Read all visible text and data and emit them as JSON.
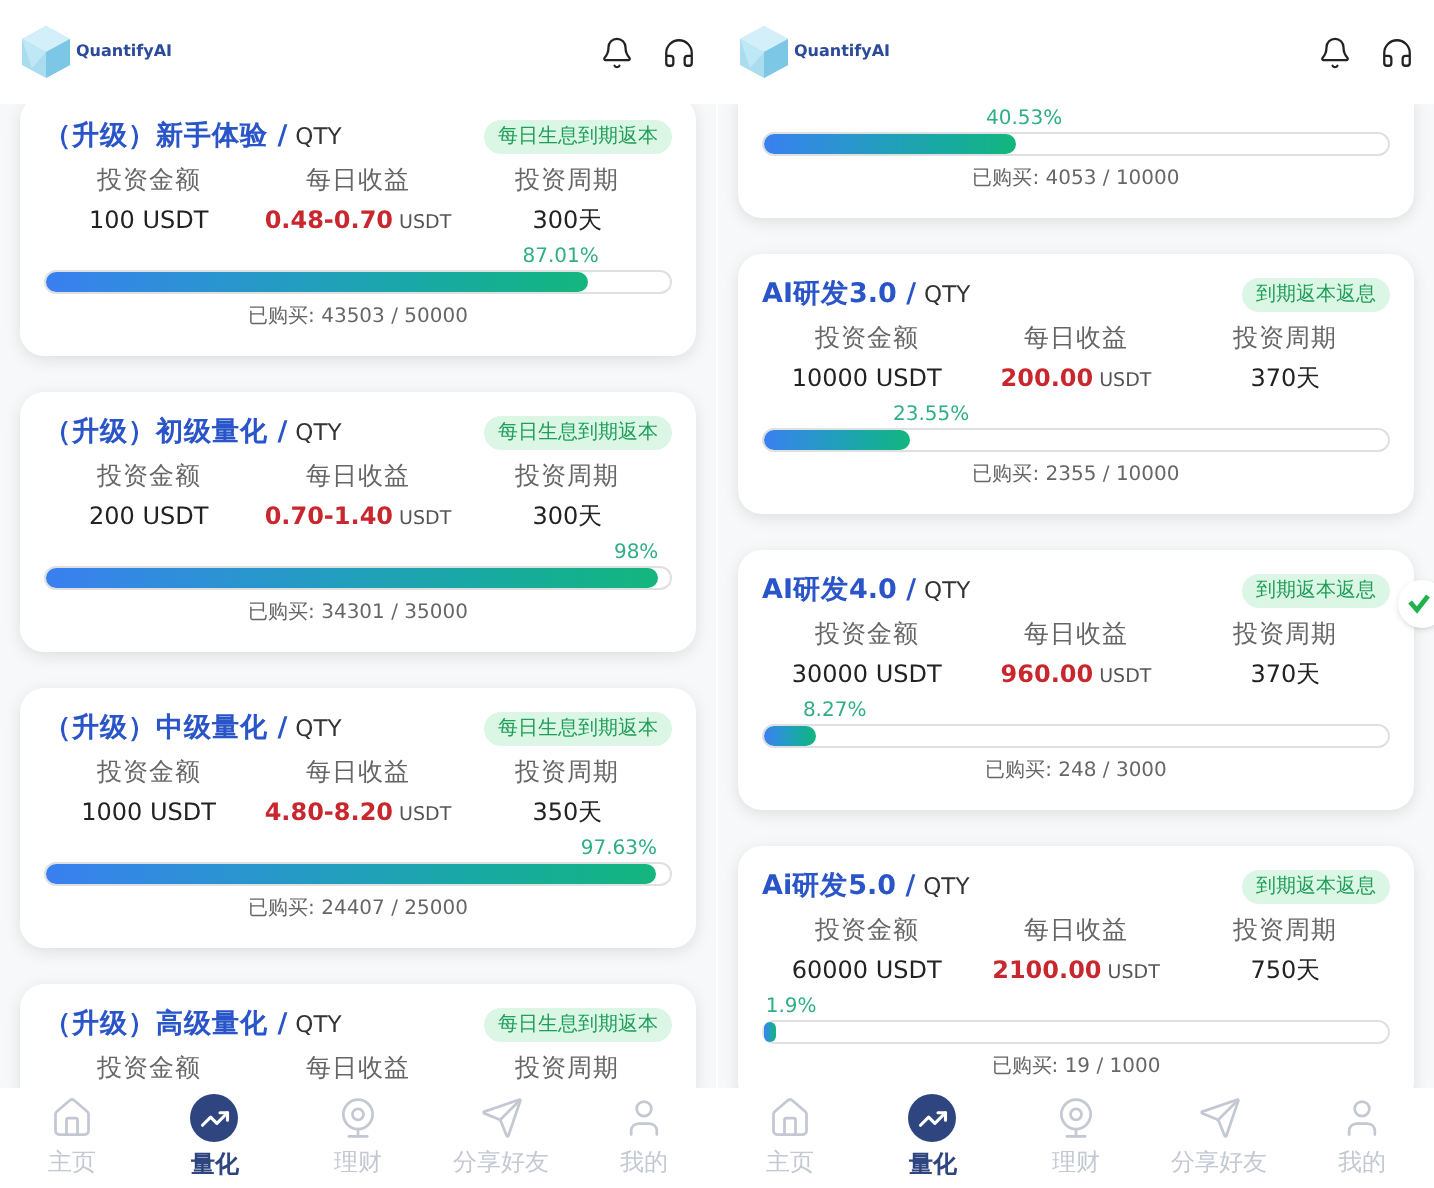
{
  "screens": [
    {
      "header": {
        "brand": "QuantifyAI"
      },
      "products": [
        {
          "title": "（升级）新手体验 /",
          "unit": "QTY",
          "badge": "每日生息到期返本",
          "stats": [
            {
              "label": "投资金额",
              "value": "100 USDT"
            },
            {
              "label": "每日收益",
              "value": "0.48-0.70",
              "suffix": "USDT"
            },
            {
              "label": "投资周期",
              "value": "300天"
            }
          ],
          "percent": "87.01%",
          "level": 0.8701,
          "purchased": "已购买: 43503 / 50000"
        },
        {
          "title": "（升级）初级量化 /",
          "unit": "QTY",
          "badge": "每日生息到期返本",
          "stats": [
            {
              "label": "投资金额",
              "value": "200 USDT"
            },
            {
              "label": "每日收益",
              "value": "0.70-1.40",
              "suffix": "USDT"
            },
            {
              "label": "投资周期",
              "value": "300天"
            }
          ],
          "percent": "98%",
          "level": 0.98,
          "purchased": "已购买: 34301 / 35000"
        },
        {
          "title": "（升级）中级量化 /",
          "unit": "QTY",
          "badge": "每日生息到期返本",
          "stats": [
            {
              "label": "投资金额",
              "value": "1000 USDT"
            },
            {
              "label": "每日收益",
              "value": "4.80-8.20",
              "suffix": "USDT"
            },
            {
              "label": "投资周期",
              "value": "350天"
            }
          ],
          "percent": "97.63%",
          "level": 0.9763,
          "purchased": "已购买: 24407 / 25000"
        },
        {
          "title": "（升级）高级量化 /",
          "unit": "QTY",
          "badge": "每日生息到期返本",
          "stats": [
            {
              "label": "投资金额"
            },
            {
              "label": "每日收益"
            },
            {
              "label": "投资周期"
            }
          ]
        }
      ],
      "nav": [
        {
          "label": "主页",
          "selected": false
        },
        {
          "label": "量化",
          "selected": true
        },
        {
          "label": "理财",
          "selected": false
        },
        {
          "label": "分享好友",
          "selected": false
        },
        {
          "label": "我的",
          "selected": false
        }
      ]
    },
    {
      "header": {
        "brand": "QuantifyAI"
      },
      "products": [
        {
          "percent": "40.53%",
          "level": 0.4053,
          "purchased": "已购买: 4053 / 10000"
        },
        {
          "title": "AI研发3.0 /",
          "unit": "QTY",
          "badge": "到期返本返息",
          "stats": [
            {
              "label": "投资金额",
              "value": "10000 USDT"
            },
            {
              "label": "每日收益",
              "value": "200.00",
              "suffix": "USDT"
            },
            {
              "label": "投资周期",
              "value": "370天"
            }
          ],
          "percent": "23.55%",
          "level": 0.2355,
          "purchased": "已购买: 2355 / 10000"
        },
        {
          "title": "AI研发4.0 /",
          "unit": "QTY",
          "badge": "到期返本返息",
          "stats": [
            {
              "label": "投资金额",
              "value": "30000 USDT"
            },
            {
              "label": "每日收益",
              "value": "960.00",
              "suffix": "USDT"
            },
            {
              "label": "投资周期",
              "value": "370天"
            }
          ],
          "percent": "8.27%",
          "level": 0.0827,
          "purchased": "已购买: 248 / 3000"
        },
        {
          "title": "Ai研发5.0 /",
          "unit": "QTY",
          "badge": "到期返本返息",
          "stats": [
            {
              "label": "投资金额",
              "value": "60000 USDT"
            },
            {
              "label": "每日收益",
              "value": "2100.00",
              "suffix": "USDT"
            },
            {
              "label": "投资周期",
              "value": "750天"
            }
          ],
          "percent": "1.9%",
          "level": 0.019,
          "purchased": "已购买: 19 / 1000"
        }
      ],
      "floating_button": true,
      "nav": [
        {
          "label": "主页",
          "selected": false
        },
        {
          "label": "量化",
          "selected": true
        },
        {
          "label": "理财",
          "selected": false
        },
        {
          "label": "分享好友",
          "selected": false
        },
        {
          "label": "我的",
          "selected": false
        }
      ]
    }
  ]
}
